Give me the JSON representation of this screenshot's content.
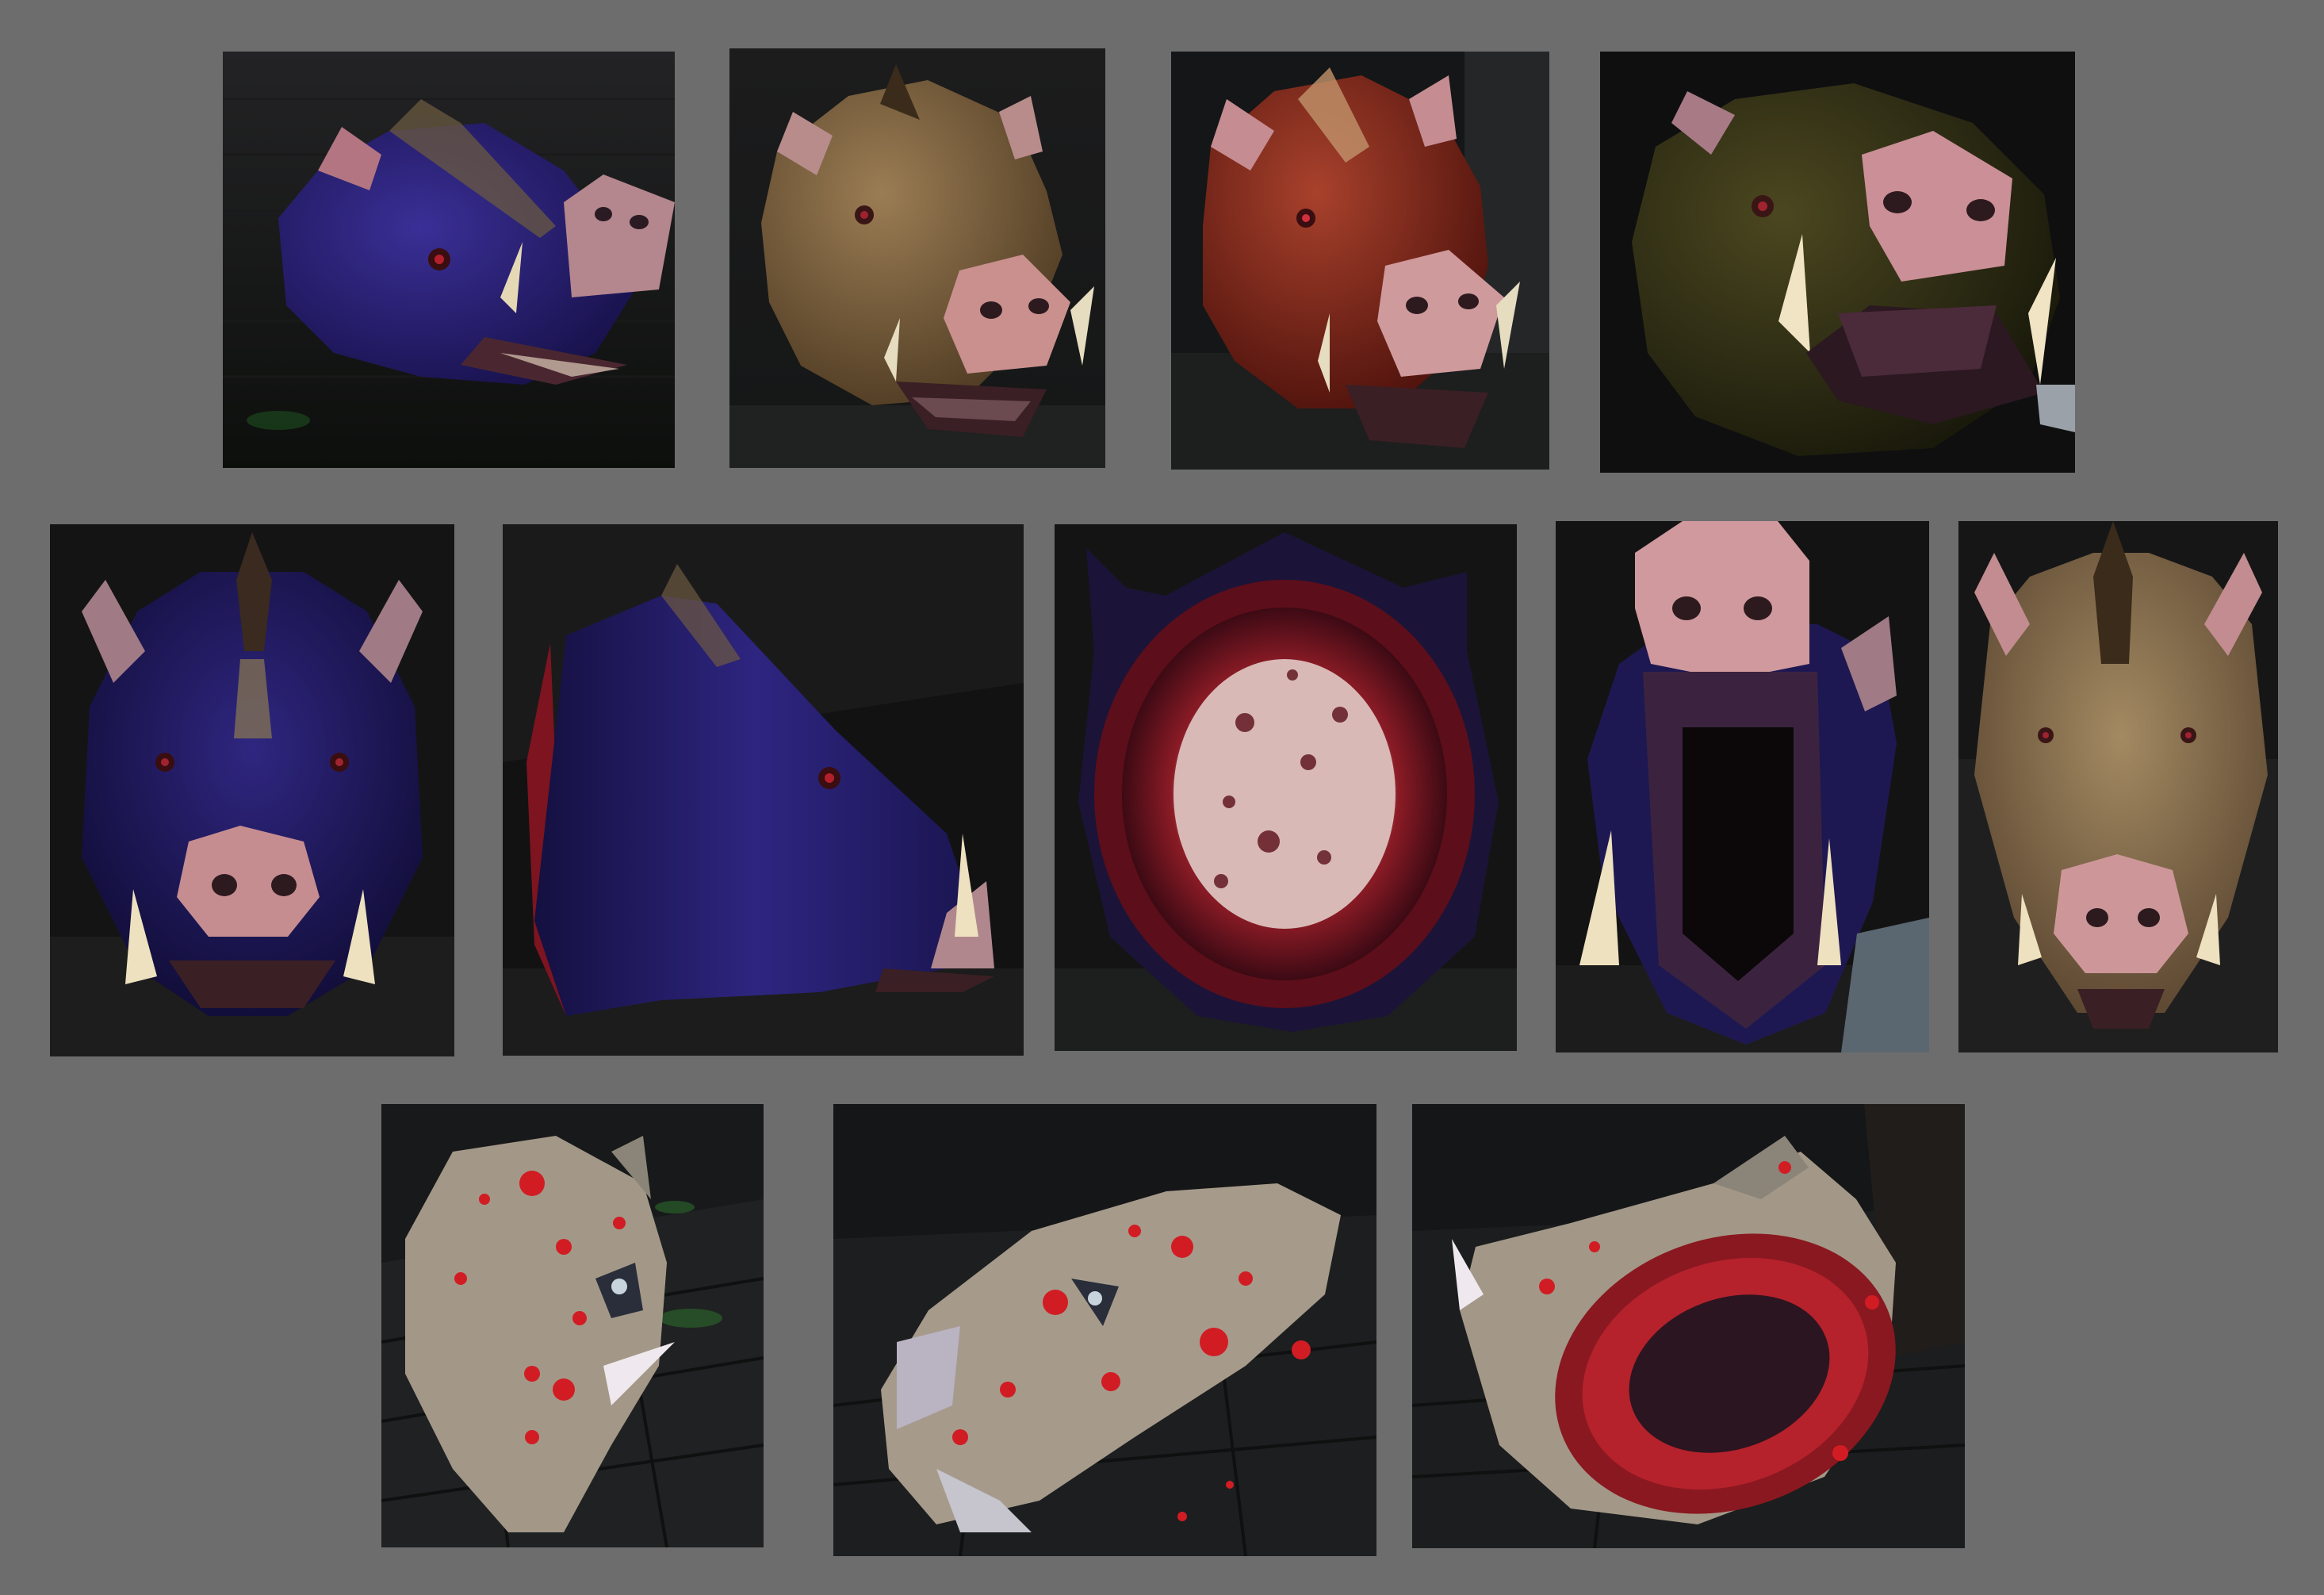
{
  "sheet": {
    "background_color": "#6d6d6d"
  },
  "tiles": [
    {
      "subject": "boar-head",
      "fur_color": "#2a2170",
      "view": "three-quarter-right"
    },
    {
      "subject": "boar-head",
      "fur_color": "#8a6d45",
      "view": "three-quarter-right"
    },
    {
      "subject": "boar-head",
      "fur_color": "#8e2a1c",
      "view": "three-quarter-right"
    },
    {
      "subject": "boar-head",
      "fur_color": "#3d3a17",
      "view": "low-angle-close-up"
    },
    {
      "subject": "boar-head",
      "fur_color": "#2a2170",
      "view": "front"
    },
    {
      "subject": "boar-head",
      "fur_color": "#2a2170",
      "view": "side-profile"
    },
    {
      "subject": "boar-head",
      "fur_color": "#2a2170",
      "view": "back-severed"
    },
    {
      "subject": "boar-head",
      "fur_color": "#2a2170",
      "view": "upward-open-mouth"
    },
    {
      "subject": "boar-head",
      "fur_color": "#8a6d45",
      "view": "front"
    },
    {
      "subject": "gibbed-boar-head",
      "fur_color": "#a49a8c",
      "view": "on-floor-angle"
    },
    {
      "subject": "gibbed-boar-head",
      "fur_color": "#a49a8c",
      "view": "on-floor-side"
    },
    {
      "subject": "gibbed-boar-head",
      "fur_color": "#a49a8c",
      "view": "on-floor-back-severed"
    }
  ]
}
